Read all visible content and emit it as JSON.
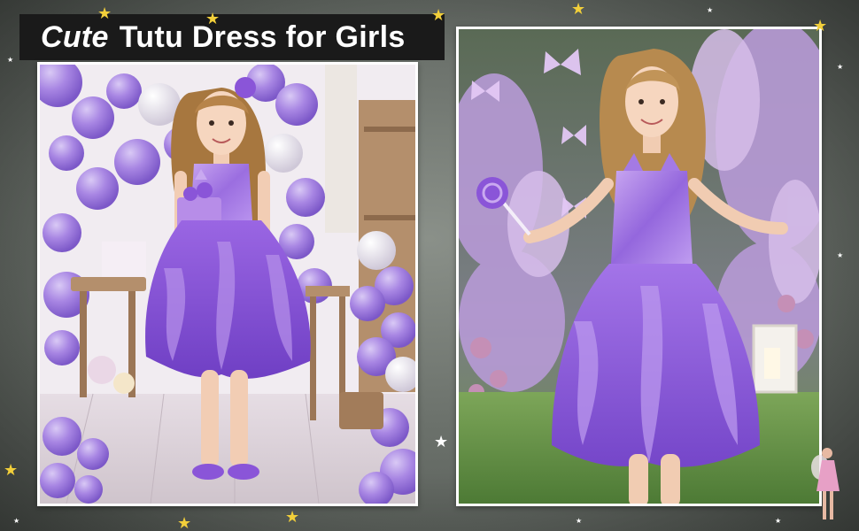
{
  "title": {
    "emphasis": "Cute",
    "rest": "Tutu Dress for Girls"
  },
  "colors": {
    "banner_bg": "#1a1a1a",
    "title_text": "#ffffff",
    "dress_purple": "#8a55d8",
    "dress_light": "#b58ae6",
    "balloon": "#a98be0",
    "star_gold": "#f2cf3a"
  },
  "photos": [
    {
      "id": "left",
      "scene": "birthday-party"
    },
    {
      "id": "right",
      "scene": "garden-butterflies"
    }
  ],
  "decor": {
    "star_icon": "star-icon",
    "cake_text": ""
  }
}
